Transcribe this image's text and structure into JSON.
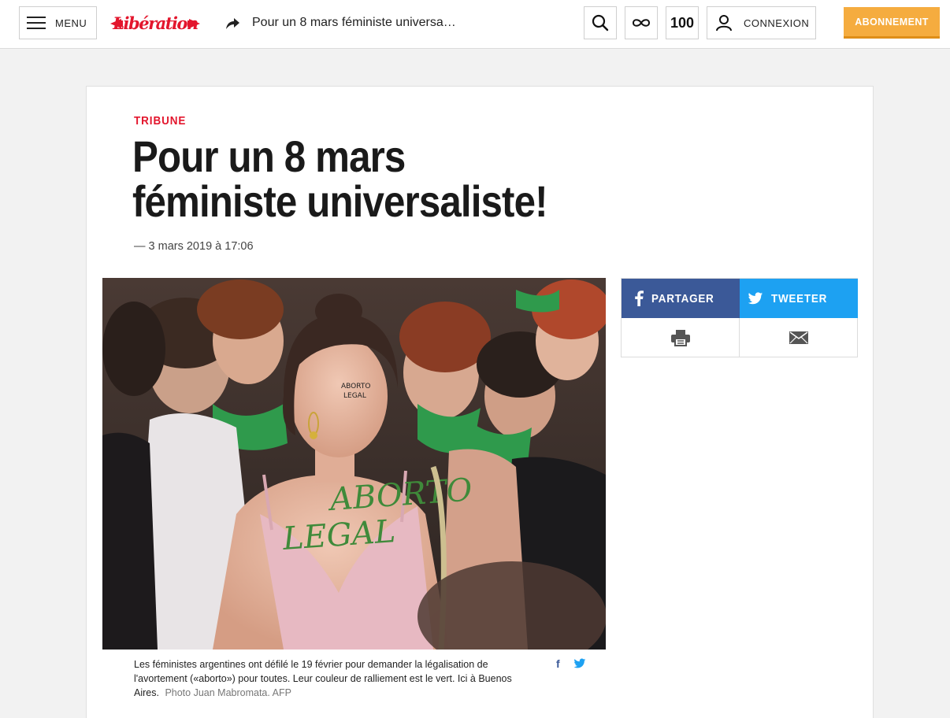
{
  "header": {
    "menu_label": "MENU",
    "logo_text": "Libération",
    "nav_headline": "Pour un 8 mars féministe universa…",
    "counter": "100",
    "connexion_label": "CONNEXION",
    "abonnement_label": "ABONNEMENT"
  },
  "article": {
    "kicker": "TRIBUNE",
    "title": "Pour un 8 mars féministe universaliste!",
    "date": "— 3 mars 2019 à 17:06",
    "caption": "Les féministes argentines ont défilé le 19 février pour demander la légalisation de l'avortement («aborto») pour toutes. Leur couleur de ralliement est le vert. Ici à Buenos Aires.",
    "credit": "Photo Juan Mabromata. AFP",
    "caption_fb": "f"
  },
  "share": {
    "facebook_label": "PARTAGER",
    "twitter_label": "TWEETER"
  },
  "colors": {
    "brand_red": "#e3162d",
    "abonnement": "#f5ac3f",
    "facebook": "#3b5998",
    "twitter": "#1da1f2"
  }
}
